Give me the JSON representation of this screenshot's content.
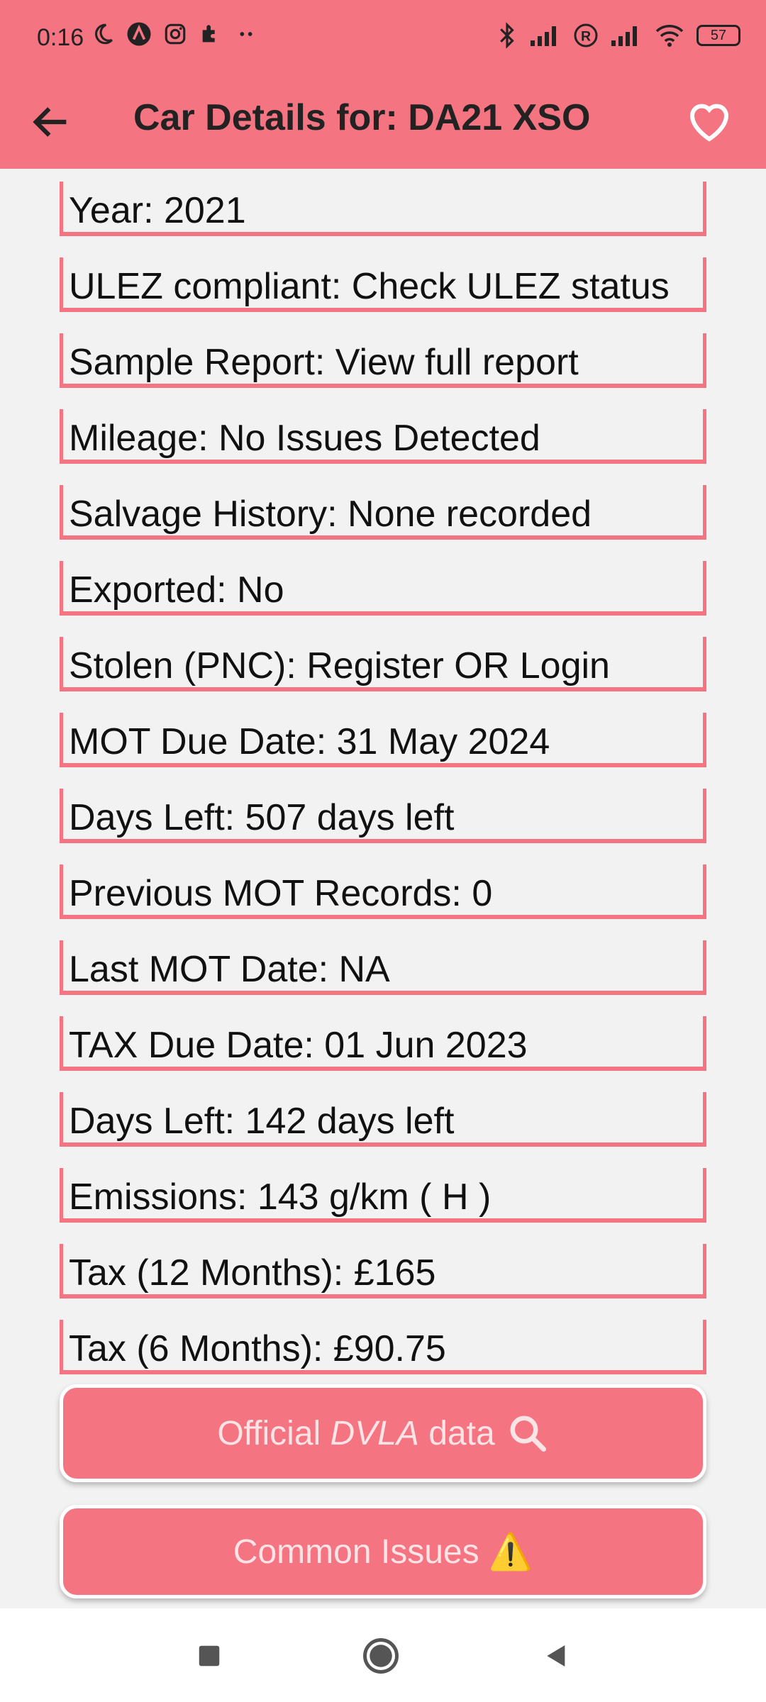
{
  "status_bar": {
    "time": "0:16",
    "battery": "57"
  },
  "header": {
    "title": "Car Details for: DA21 XSO"
  },
  "details": [
    "Year: 2021",
    "ULEZ compliant: Check ULEZ status",
    "Sample Report: View full report",
    "Mileage: No Issues Detected",
    "Salvage History: None recorded",
    "Exported: No",
    "Stolen (PNC): Register OR Login",
    "MOT Due Date: 31 May 2024",
    "Days Left: 507 days left",
    "Previous MOT Records: 0",
    "Last MOT Date: NA",
    "TAX Due Date: 01 Jun 2023",
    "Days Left: 142 days left",
    "Emissions: 143 g/km ( H )",
    "Tax (12 Months): £165",
    "Tax (6 Months): £90.75"
  ],
  "buttons": {
    "dvla_prefix": "Official",
    "dvla_emph": "DVLA",
    "dvla_suffix": "data",
    "dvla_icon": "search-icon",
    "issues_label": "Common Issues",
    "issues_icon": "⚠️"
  },
  "colors": {
    "accent": "#f47481",
    "background": "#f2f2f2"
  }
}
